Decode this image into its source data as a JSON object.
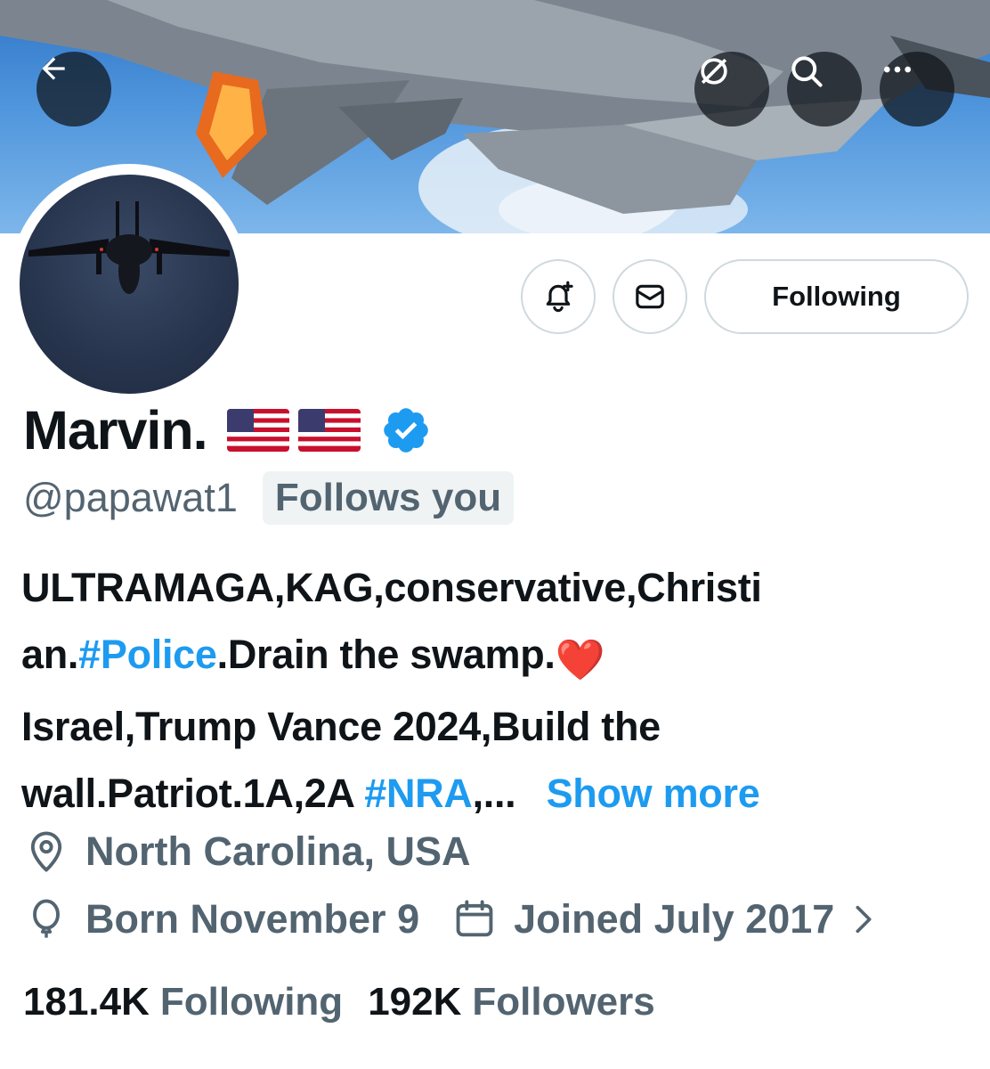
{
  "header": {
    "back_icon": "arrow-left-icon",
    "grok_icon": "grok-icon",
    "search_icon": "search-icon",
    "more_icon": "more-horizontal-icon"
  },
  "actions": {
    "notify_icon": "bell-plus-icon",
    "message_icon": "mail-icon",
    "following_label": "Following"
  },
  "profile": {
    "display_name": "Marvin.",
    "flags": [
      "🇺🇸",
      "🇺🇸"
    ],
    "verified": true,
    "handle": "@papawat1",
    "follows_you": "Follows you",
    "bio": {
      "line1": "ULTRAMAGA,KAG,conservative,Christi",
      "line2_prefix": "an.",
      "line2_link": "#Police",
      "line2_suffix": ".Drain the swamp.",
      "line2_emoji": "❤️",
      "line3": "Israel,Trump Vance 2024,Build the",
      "line4_prefix": "wall.Patriot.1A,2A ",
      "line4_link": "#NRA",
      "line4_suffix": ",...",
      "show_more": "Show more"
    },
    "location": "North Carolina, USA",
    "birthday": "Born November 9",
    "joined": "Joined July 2017"
  },
  "stats": {
    "following_count": "181.4K",
    "following_label": "Following",
    "followers_count": "192K",
    "followers_label": "Followers"
  },
  "colors": {
    "accent": "#1d9bf0",
    "secondary_text": "#536471",
    "primary_text": "#0f1419",
    "verified_badge": "#1d9bf0"
  }
}
